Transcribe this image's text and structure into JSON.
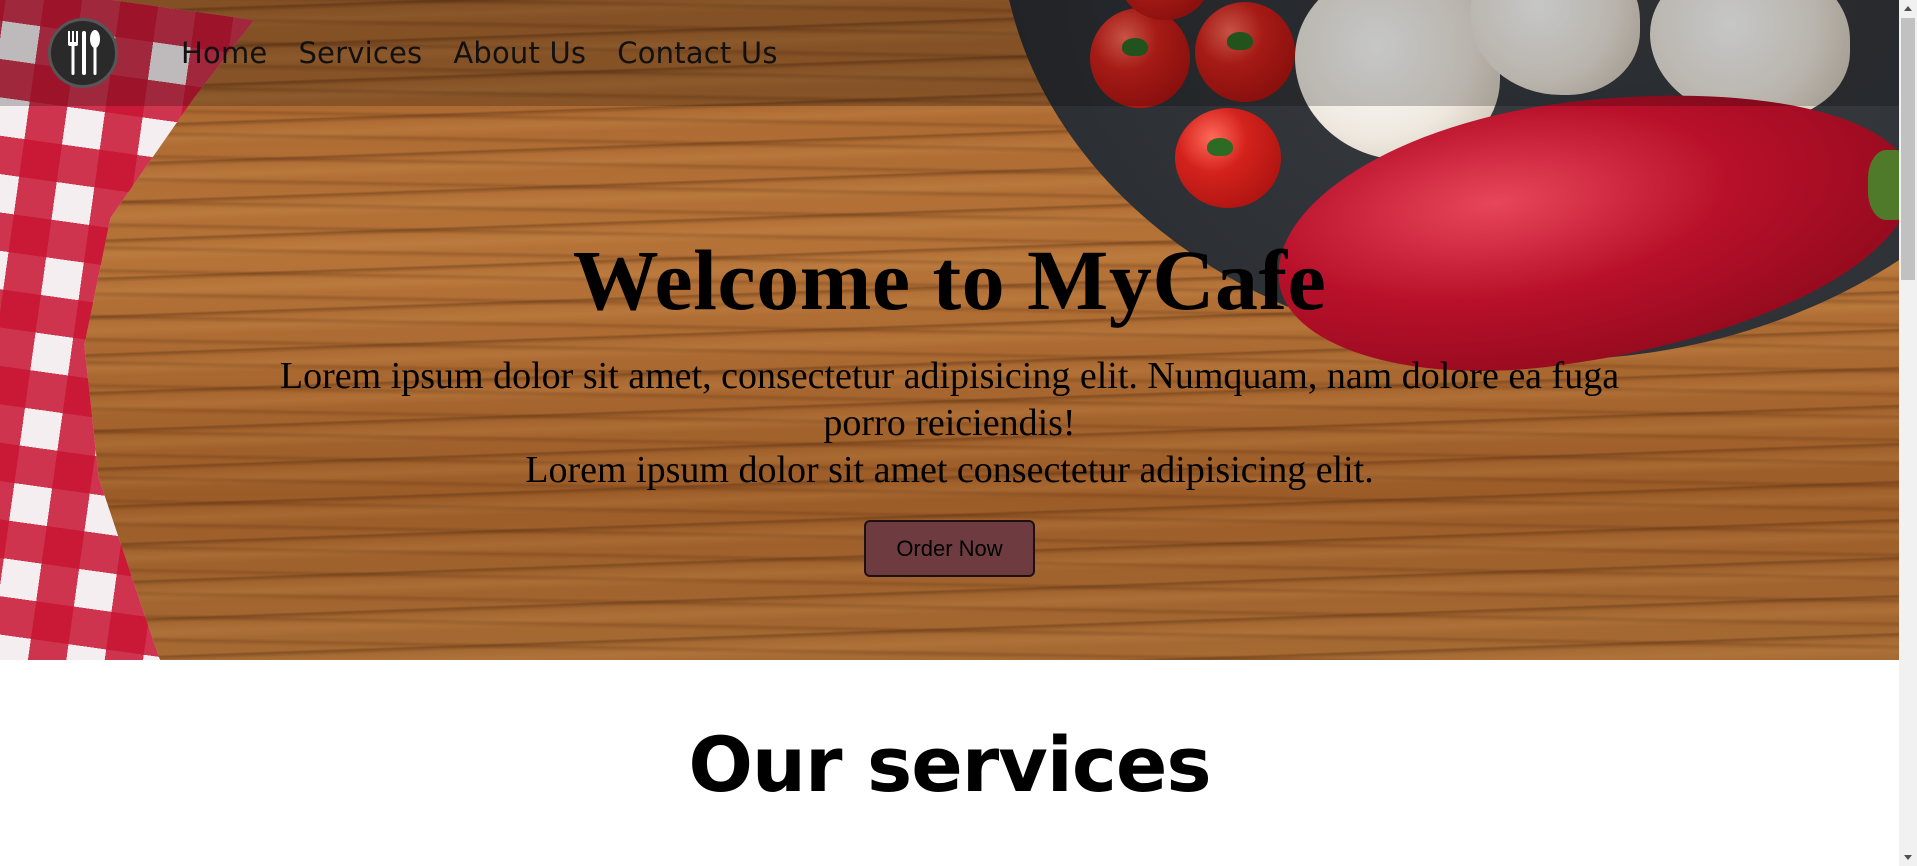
{
  "nav": {
    "items": [
      {
        "label": "Home"
      },
      {
        "label": "Services"
      },
      {
        "label": "About Us"
      },
      {
        "label": "Contact Us"
      }
    ]
  },
  "hero": {
    "title": "Welcome to MyCafe",
    "text_line1": "Lorem ipsum dolor sit amet, consectetur adipisicing elit. Numquam, nam dolore ea fuga porro reiciendis!",
    "text_line2": "Lorem ipsum dolor sit amet consectetur adipisicing elit.",
    "button_label": "Order Now"
  },
  "services": {
    "title": "Our services"
  },
  "icons": {
    "logo": "cutlery-icon",
    "scroll_up": "scroll-up-arrow-icon",
    "scroll_down": "scroll-down-arrow-icon"
  },
  "colors": {
    "button_bg": "#6e3c40",
    "nav_overlay": "rgba(0,0,0,0.22)",
    "text": "#000000"
  }
}
